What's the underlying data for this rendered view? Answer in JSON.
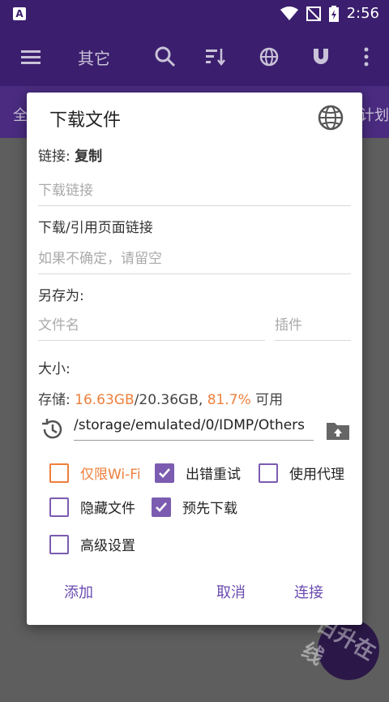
{
  "status": {
    "time": "2:56",
    "app_badge": "A"
  },
  "appbar": {
    "title": "其它"
  },
  "tabs": {
    "left": "全",
    "right": "计划"
  },
  "watermark": "日升在线",
  "dialog": {
    "title": "下载文件",
    "link_label": "链接:",
    "link_copy": "复制",
    "link_placeholder": "下载链接",
    "ref_label": "下载/引用页面链接",
    "ref_placeholder": "如果不确定，请留空",
    "saveas_label": "另存为:",
    "filename_placeholder": "文件名",
    "plugin_placeholder": "插件",
    "size_label": "大小:",
    "storage": {
      "label": "存储:",
      "free": "16.63GB",
      "sep": "/",
      "total": "20.36GB,",
      "percent": "81.7%",
      "suffix": "可用"
    },
    "path": "/storage/emulated/0/IDMP/Others",
    "options": [
      {
        "label": "仅限Wi-Fi",
        "checked": false
      },
      {
        "label": "出错重试",
        "checked": true
      },
      {
        "label": "使用代理",
        "checked": false
      },
      {
        "label": "隐藏文件",
        "checked": false
      },
      {
        "label": "预先下载",
        "checked": true
      },
      {
        "label": "高级设置",
        "checked": false
      }
    ],
    "buttons": {
      "add": "添加",
      "cancel": "取消",
      "connect": "连接"
    }
  },
  "colors": {
    "accent": "#7b5cb0",
    "orange": "#ee7f3c",
    "appbar": "#3b1f6e"
  }
}
